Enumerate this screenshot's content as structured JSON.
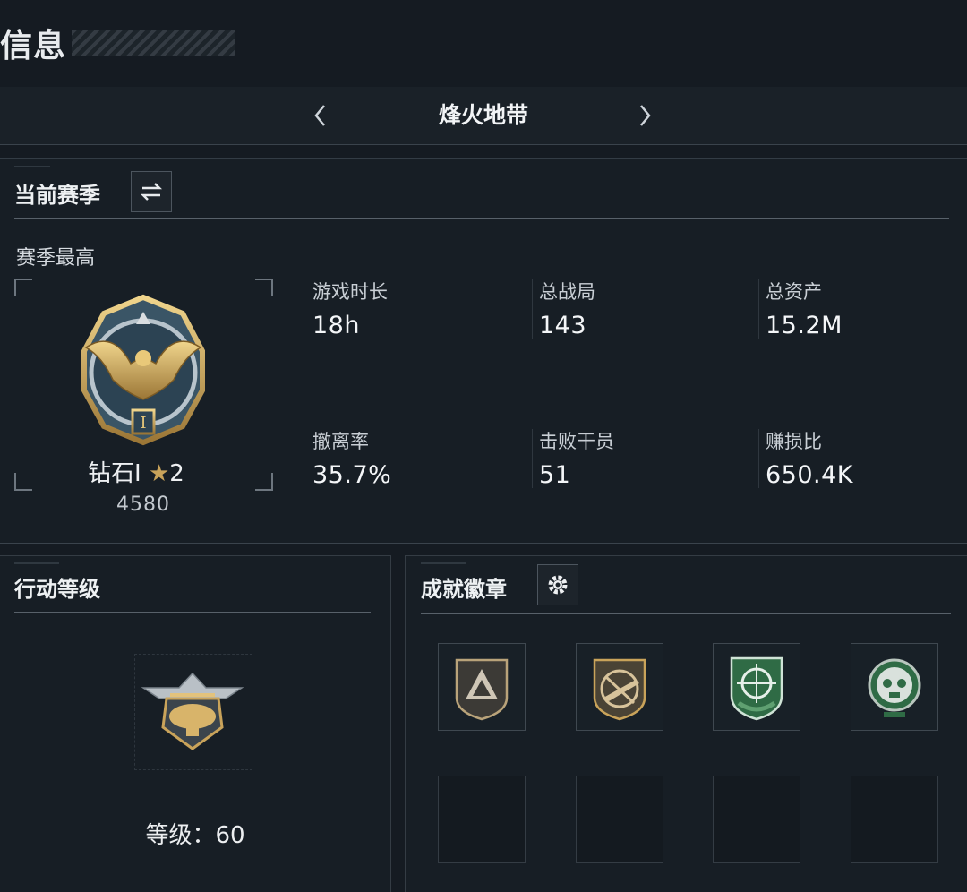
{
  "header": {
    "title": "信息",
    "mode_name": "烽火地带",
    "prev_icon": "chevron-left-icon",
    "next_icon": "chevron-right-icon"
  },
  "season": {
    "title": "当前赛季",
    "switch_icon": "switch-arrows-icon",
    "best_label": "赛季最高",
    "rank_name": "钻石I",
    "rank_stars": "2",
    "rank_score": "4580",
    "stats": [
      {
        "label": "游戏时长",
        "value": "18h"
      },
      {
        "label": "总战局",
        "value": "143"
      },
      {
        "label": "总资产",
        "value": "15.2M"
      },
      {
        "label": "撤离率",
        "value": "35.7%"
      },
      {
        "label": "击败干员",
        "value": "51"
      },
      {
        "label": "赚损比",
        "value": "650.4K"
      }
    ]
  },
  "level": {
    "title": "行动等级",
    "level_text": "等级：60"
  },
  "badges": {
    "title": "成就徽章",
    "settings_icon": "gear-icon",
    "items": [
      "triangle-badge-icon",
      "rifle-badge-icon",
      "sniper-badge-icon",
      "skull-badge-icon"
    ]
  },
  "colors": {
    "background": "#151b22",
    "gold": "#c9a35a",
    "green_badge": "#2f6b45"
  }
}
